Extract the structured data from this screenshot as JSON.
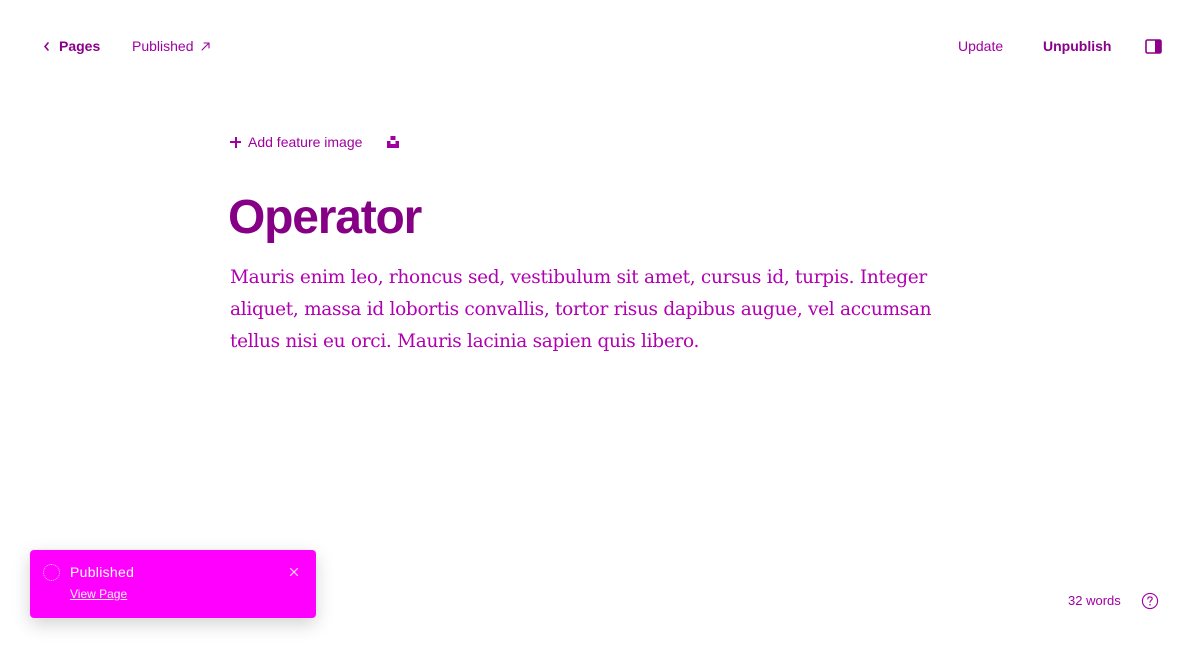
{
  "header": {
    "back_label": "Pages",
    "status_label": "Published",
    "update_label": "Update",
    "unpublish_label": "Unpublish"
  },
  "editor": {
    "add_feature_image_label": "Add feature image",
    "title": "Operator",
    "body": "Mauris enim leo, rhoncus sed, vestibulum sit amet, cursus id, turpis. Integer aliquet, massa id lobortis convallis, tortor risus dapibus augue, vel accumsan tellus nisi eu orci. Mauris lacinia sapien quis libero."
  },
  "toast": {
    "title": "Published",
    "link_label": "View Page",
    "background_color": "#ff00ff"
  },
  "footer": {
    "word_count": "32 words"
  },
  "icons": {
    "back": "chevron-left-icon",
    "status": "arrow-up-right-icon",
    "sidebar": "sidebar-toggle-icon",
    "plus": "plus-icon",
    "unsplash": "unsplash-icon",
    "spinner": "spinner-icon",
    "close": "close-icon",
    "help": "help-icon"
  },
  "colors": {
    "accent": "#8a008a",
    "text": "#a000a0",
    "body_text": "#b000b0",
    "toast": "#ff00ff"
  }
}
